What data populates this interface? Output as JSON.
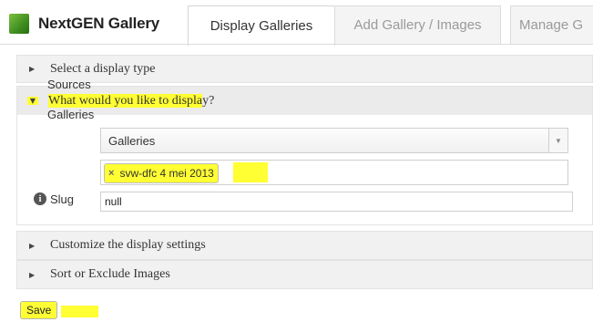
{
  "header": {
    "brand": "NextGEN Gallery",
    "tabs": [
      {
        "label": "Display Galleries",
        "active": true
      },
      {
        "label": "Add Gallery / Images",
        "active": false
      },
      {
        "label": "Manage G",
        "active": false
      }
    ]
  },
  "accordion": {
    "sections": [
      {
        "label": "Select a display type",
        "expanded": false
      },
      {
        "label_highlighted": "What would you like to displa",
        "label_rest": "y?",
        "expanded": true
      },
      {
        "label": "Customize the display settings",
        "expanded": false
      },
      {
        "label": "Sort or Exclude Images",
        "expanded": false
      }
    ]
  },
  "display_form": {
    "sources_label": "Sources",
    "sources_value": "Galleries",
    "galleries_label": "Galleries",
    "gallery_chip": "svw-dfc 4 mei 2013",
    "slug_label": "Slug",
    "slug_value": "null"
  },
  "actions": {
    "save_label": "Save"
  },
  "colors": {
    "highlight": "#ffff33",
    "brand_green": "#3f8f1f"
  }
}
